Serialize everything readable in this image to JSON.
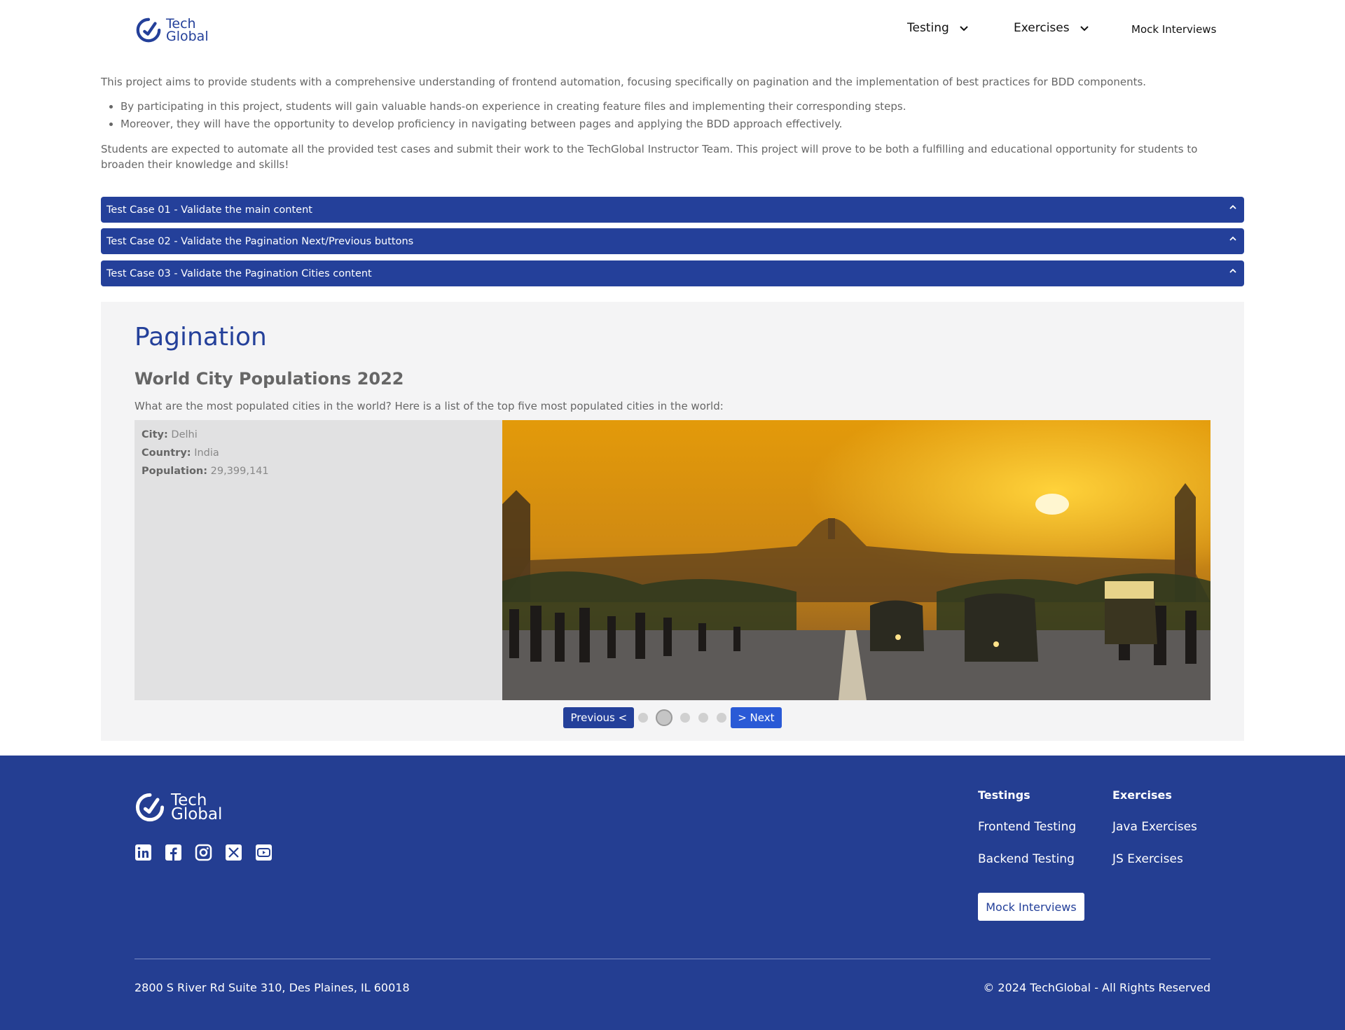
{
  "header": {
    "logo_line1": "Tech",
    "logo_line2": "Global",
    "nav": {
      "testing": "Testing",
      "exercises": "Exercises",
      "mock": "Mock Interviews"
    }
  },
  "intro": {
    "p1": "This project aims to provide students with a comprehensive understanding of frontend automation, focusing specifically on pagination and the implementation of best practices for BDD components.",
    "bullets": [
      "By participating in this project, students will gain valuable hands-on experience in creating feature files and implementing their corresponding steps.",
      "Moreover, they will have the opportunity to develop proficiency in navigating between pages and applying the BDD approach effectively."
    ],
    "p2": "Students are expected to automate all the provided test cases and submit their work to the TechGlobal Instructor Team. This project will prove to be both a fulfilling and educational opportunity for students to broaden their knowledge and skills!"
  },
  "accordions": [
    "Test Case 01 - Validate the main content",
    "Test Case 02 - Validate the Pagination Next/Previous buttons",
    "Test Case 03 - Validate the Pagination Cities content"
  ],
  "main": {
    "title": "Pagination",
    "subtitle": "World City Populations 2022",
    "description": "What are the most populated cities in the world? Here is a list of the top five most populated cities in the world:",
    "city_label": "City:",
    "city": "Delhi",
    "country_label": "Country:",
    "country": "India",
    "population_label": "Population:",
    "population": "29,399,141",
    "prev": "Previous <",
    "next": "> Next",
    "active_page": 2,
    "total_pages": 5
  },
  "footer": {
    "logo_line1": "Tech",
    "logo_line2": "Global",
    "social_icons": [
      "linkedin-icon",
      "facebook-icon",
      "instagram-icon",
      "x-icon",
      "youtube-icon"
    ],
    "col1_title": "Testings",
    "col1_links": [
      "Frontend Testing",
      "Backend Testing"
    ],
    "col2_title": "Exercises",
    "col2_links": [
      "Java Exercises",
      "JS Exercises"
    ],
    "mock_button": "Mock Interviews",
    "address": "2800 S River Rd Suite 310, Des Plaines, IL 60018",
    "copyright": "© 2024 TechGlobal - All Rights Reserved"
  },
  "colors": {
    "brand": "#24409a",
    "next_button": "#2a5ad6",
    "card_bg": "#f4f4f5"
  }
}
